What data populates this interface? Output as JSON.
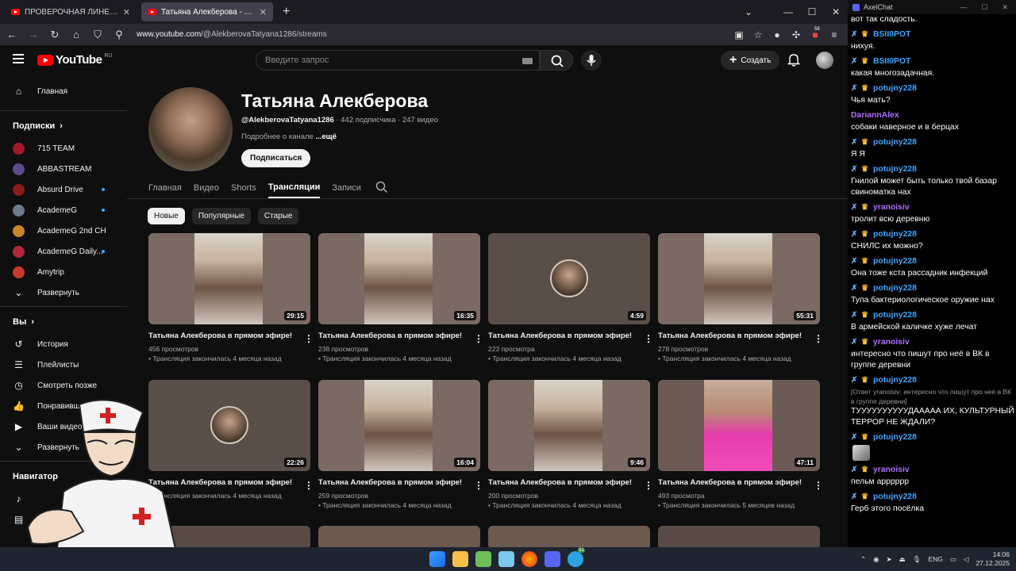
{
  "browser": {
    "tabs": [
      {
        "label": "ПРОВЕРОЧНАЯ ЛИНЕЙКА - М",
        "active": false
      },
      {
        "label": "Татьяна Алекберова - YouTube",
        "active": true
      }
    ],
    "new_tab": "+",
    "url_prefix": "www.youtube.com",
    "url_path": "/@AlekberovaTatyana1286/streams",
    "ext_badge": "58"
  },
  "yt_header": {
    "logo_text": "YouTube",
    "logo_region": "RU",
    "search_placeholder": "Введите запрос",
    "create_label": "Создать"
  },
  "sidebar": {
    "home_label": "Главная",
    "subs_heading": "Подписки",
    "subscriptions": [
      {
        "label": "715 TEAM",
        "color": "#a3192b",
        "dot": false
      },
      {
        "label": "ABBASTREAM",
        "color": "#5d4b8c",
        "dot": false
      },
      {
        "label": "Absurd Drive",
        "color": "#8b1a1a",
        "dot": true
      },
      {
        "label": "AcademeG",
        "color": "#6e7b8c",
        "dot": true
      },
      {
        "label": "AcademeG 2nd CH",
        "color": "#c9862a",
        "dot": false
      },
      {
        "label": "AcademeG Daily...",
        "color": "#b0283c",
        "dot": true
      },
      {
        "label": "Amytrip",
        "color": "#c83a2a",
        "dot": false
      }
    ],
    "expand_label": "Развернуть",
    "you_heading": "Вы",
    "you_items": [
      {
        "label": "История",
        "icon": "history-icon"
      },
      {
        "label": "Плейлисты",
        "icon": "playlist-icon"
      },
      {
        "label": "Смотреть позже",
        "icon": "clock-icon"
      },
      {
        "label": "Понравившиеся",
        "icon": "thumbs-up-icon"
      },
      {
        "label": "Ваши видео",
        "icon": "video-icon"
      },
      {
        "label": "Развернуть",
        "icon": "chevron-down-icon"
      }
    ],
    "nav_heading": "Навигатор"
  },
  "channel": {
    "name": "Татьяна Алекберова",
    "handle": "@AlekberovaTatyana1286",
    "stats": " · 442 подписчика · 247 видео",
    "about_prefix": "Подробнее о канале ",
    "about_more": "...ещё",
    "subscribe_label": "Подписаться",
    "tabs": [
      {
        "label": "Главная",
        "active": false
      },
      {
        "label": "Видео",
        "active": false
      },
      {
        "label": "Shorts",
        "active": false
      },
      {
        "label": "Трансляции",
        "active": true
      },
      {
        "label": "Записи",
        "active": false
      }
    ],
    "chips": [
      {
        "label": "Новые",
        "active": true
      },
      {
        "label": "Популярные",
        "active": false
      },
      {
        "label": "Старые",
        "active": false
      }
    ]
  },
  "videos": [
    {
      "title": "Татьяна Алекберова в прямом эфире!",
      "duration": "29:15",
      "views": "456 просмотров",
      "ago": "• Трансляция закончилась 4 месяца назад",
      "style": "face"
    },
    {
      "title": "Татьяна Алекберова в прямом эфире!",
      "duration": "16:35",
      "views": "238 просмотров",
      "ago": "• Трансляция закончилась 4 месяца назад",
      "style": "face"
    },
    {
      "title": "Татьяна Алекберова в прямом эфире!",
      "duration": "4:59",
      "views": "223 просмотра",
      "ago": "• Трансляция закончилась 4 месяца назад",
      "style": "circle"
    },
    {
      "title": "Татьяна Алекберова в прямом эфире!",
      "duration": "55:31",
      "views": "278 просмотров",
      "ago": "• Трансляция закончилась 4 месяца назад",
      "style": "face"
    },
    {
      "title": "Татьяна Алекберова в прямом эфире!",
      "duration": "22:26",
      "views": "",
      "ago": "• Трансляция закончилась 4 месяца назад",
      "style": "circle"
    },
    {
      "title": "Татьяна Алекберова в прямом эфире!",
      "duration": "16:04",
      "views": "259 просмотров",
      "ago": "• Трансляция закончилась 4 месяца назад",
      "style": "face"
    },
    {
      "title": "Татьяна Алекберова в прямом эфире!",
      "duration": "9:46",
      "views": "200 просмотров",
      "ago": "• Трансляция закончилась 4 месяца назад",
      "style": "face"
    },
    {
      "title": "Татьяна Алекберова в прямом эфире!",
      "duration": "47:11",
      "views": "493 просмотра",
      "ago": "• Трансляция закончилась 5 месяцев назад",
      "style": "pink"
    }
  ],
  "chat": {
    "title": "AxelChat",
    "messages": [
      {
        "user": "",
        "text": "вот так сладость."
      },
      {
        "user": "BSII0POT",
        "color": "#3ea6ff",
        "badges": true,
        "text": "нихуя."
      },
      {
        "user": "BSII0POT",
        "color": "#3ea6ff",
        "badges": true,
        "text": "какая многозадачная."
      },
      {
        "user": "potujny228",
        "color": "#3ea6ff",
        "badges": true,
        "text": "Чья мать?"
      },
      {
        "user": "DariannAlex",
        "color": "#b070ff",
        "badges": false,
        "text": "собаки наверное и в берцах"
      },
      {
        "user": "potujny228",
        "color": "#3ea6ff",
        "badges": true,
        "text": "Я Я"
      },
      {
        "user": "potujny228",
        "color": "#3ea6ff",
        "badges": true,
        "text": "Гнилой может быть только твой базар свиноматка нах"
      },
      {
        "user": "yranoisiv",
        "color": "#b070ff",
        "badges": true,
        "text": "тролит всю деревню"
      },
      {
        "user": "potujny228",
        "color": "#3ea6ff",
        "badges": true,
        "text": "СНИЛС их можно?"
      },
      {
        "user": "potujny228",
        "color": "#3ea6ff",
        "badges": true,
        "text": "Она тоже кста рассадник инфекций"
      },
      {
        "user": "potujny228",
        "color": "#3ea6ff",
        "badges": true,
        "text": "Тупа бактериологическое оружие нах"
      },
      {
        "user": "potujny228",
        "color": "#3ea6ff",
        "badges": true,
        "text": "В армейской каличке хуже лечат"
      },
      {
        "user": "yranoisiv",
        "color": "#b070ff",
        "badges": true,
        "text": "интересно что пишут про неё в ВК в группе деревни"
      },
      {
        "user": "potujny228",
        "color": "#3ea6ff",
        "badges": true,
        "reply": "[Ответ yranoisiv: интересно что пишут про неё в ВК в группе деревни]",
        "text": "ТУУУУУУУУУУДААААА ИХ, КУЛЬТУРНЫЙ ТЕРРОР НЕ ЖДАЛИ?"
      },
      {
        "user": "potujny228",
        "color": "#3ea6ff",
        "badges": true,
        "text": "",
        "sticker": true
      },
      {
        "user": "yranoisiv",
        "color": "#b070ff",
        "badges": true,
        "text": "пельм арррррр"
      },
      {
        "user": "potujny228",
        "color": "#3ea6ff",
        "badges": true,
        "text": "Герб этого посёлка"
      }
    ]
  },
  "taskbar": {
    "lang": "ENG",
    "time": "14:06",
    "date": "27.12.2025",
    "telegram_badge": "51"
  }
}
